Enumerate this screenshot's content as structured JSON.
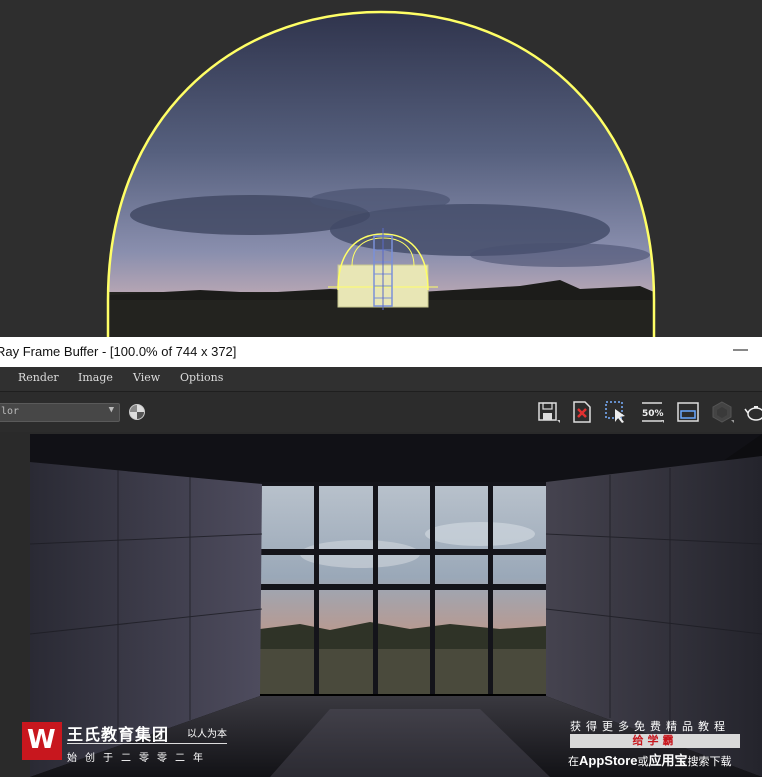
{
  "window": {
    "title": "Ray Frame Buffer - [100.0% of 744 x 372]",
    "minimize_glyph": "—"
  },
  "menu": [
    "Render",
    "Image",
    "View",
    "Options"
  ],
  "toolbar": {
    "channel_value": "lor",
    "channel_arrow": "▼",
    "zoom_label": "50%",
    "buttons": [
      "save-icon",
      "clear-icon",
      "region-select-icon",
      "zoom-50-icon",
      "frame-icon",
      "lens-effects-icon",
      "teapot-icon"
    ]
  },
  "colors": {
    "gizmo_yellow": "#ffff66",
    "titlebar_bg": "#ffffff",
    "vfb_bg": "#2a2a2a",
    "brand_red": "#c8171e"
  },
  "watermark_left": {
    "logo_letter": "W",
    "name": "王氏教育集团",
    "motto": "以人为本",
    "sub": "始创于二零零二年"
  },
  "watermark_right": {
    "line1": "获得更多免费精品教程",
    "line2": "给学霸",
    "line3_prefix": "在",
    "appstore": "AppStore",
    "line3_mid": "或",
    "app_name": "应用宝",
    "line3_suffix": "搜索下载"
  }
}
